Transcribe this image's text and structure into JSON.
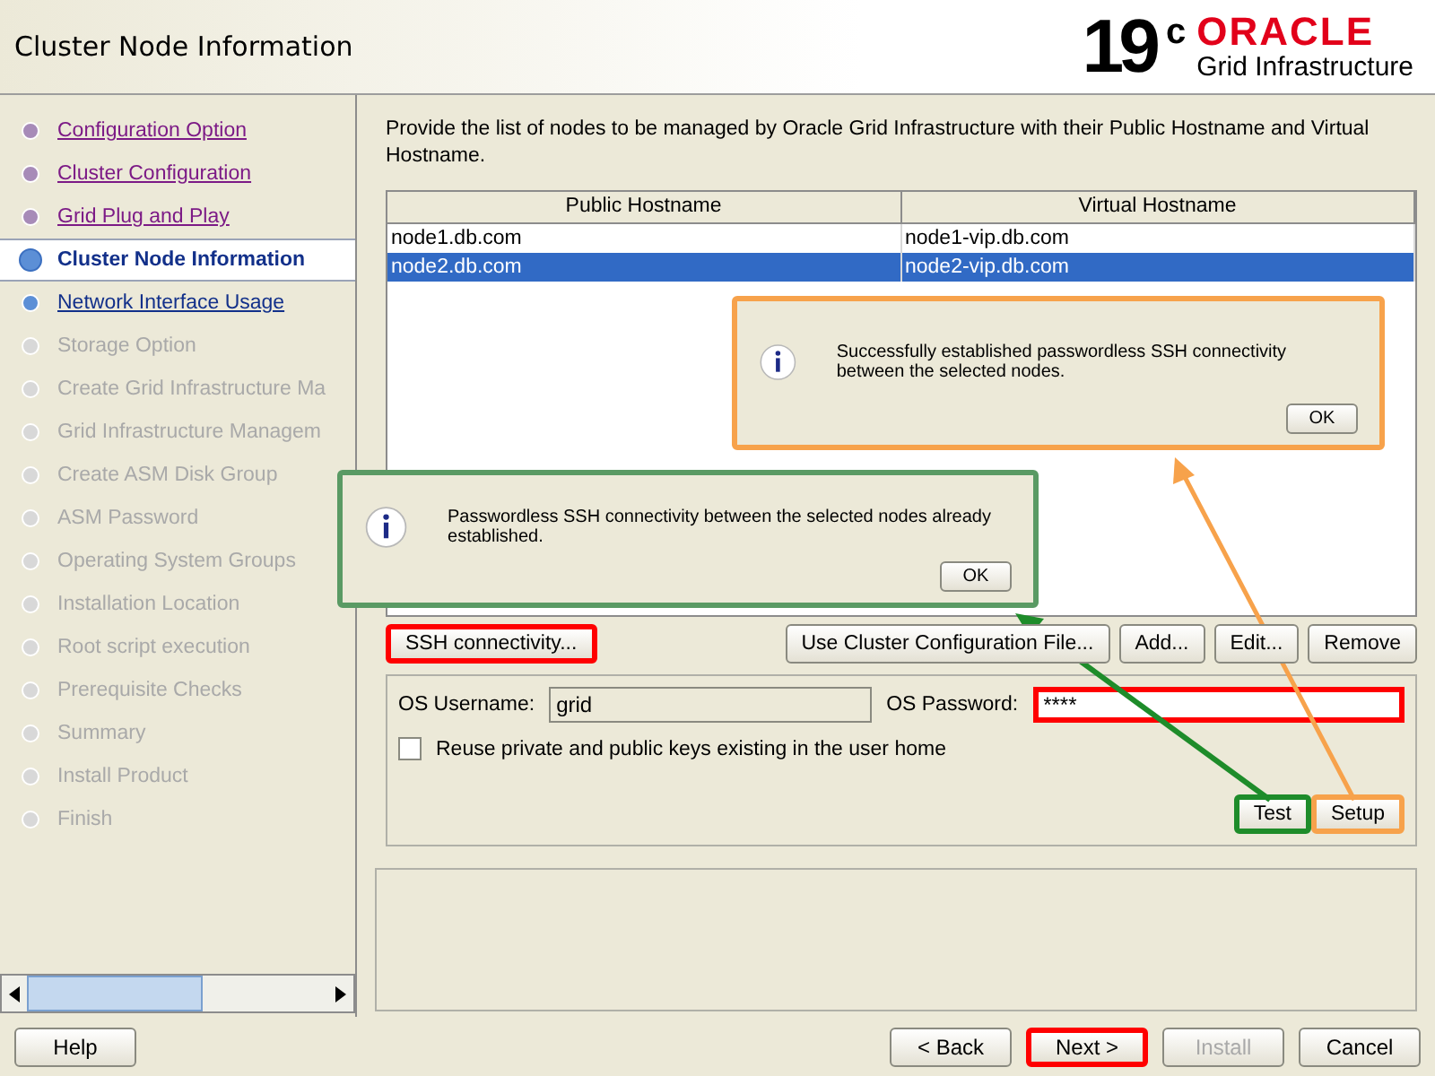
{
  "header": {
    "title": "Cluster Node Information",
    "logo": {
      "version": "19",
      "suffix": "c",
      "brand": "ORACLE",
      "product": "Grid Infrastructure"
    }
  },
  "steps": [
    {
      "label": "Configuration Option",
      "kind": "done",
      "selected": false
    },
    {
      "label": "Cluster Configuration",
      "kind": "done",
      "selected": false
    },
    {
      "label": "Grid Plug and Play",
      "kind": "done",
      "selected": false
    },
    {
      "label": "Cluster Node Information",
      "kind": "current",
      "selected": true
    },
    {
      "label": "Network Interface Usage",
      "kind": "next",
      "selected": false
    },
    {
      "label": "Storage Option",
      "kind": "pending",
      "selected": false
    },
    {
      "label": "Create Grid Infrastructure Ma",
      "kind": "pending",
      "selected": false
    },
    {
      "label": "Grid Infrastructure Managem",
      "kind": "pending",
      "selected": false
    },
    {
      "label": "Create ASM Disk Group",
      "kind": "pending",
      "selected": false
    },
    {
      "label": "ASM Password",
      "kind": "pending",
      "selected": false
    },
    {
      "label": "Operating System Groups",
      "kind": "pending",
      "selected": false
    },
    {
      "label": "Installation Location",
      "kind": "pending",
      "selected": false
    },
    {
      "label": "Root script execution",
      "kind": "pending",
      "selected": false
    },
    {
      "label": "Prerequisite Checks",
      "kind": "pending",
      "selected": false
    },
    {
      "label": "Summary",
      "kind": "pending",
      "selected": false
    },
    {
      "label": "Install Product",
      "kind": "pending",
      "selected": false
    },
    {
      "label": "Finish",
      "kind": "pending",
      "selected": false
    }
  ],
  "instruction": "Provide the list of nodes to be managed by Oracle Grid Infrastructure with their Public Hostname and Virtual Hostname.",
  "table": {
    "columns": [
      "Public Hostname",
      "Virtual Hostname"
    ],
    "rows": [
      {
        "cells": [
          "node1.db.com",
          "node1-vip.db.com"
        ],
        "selected": false
      },
      {
        "cells": [
          "node2.db.com",
          "node2-vip.db.com"
        ],
        "selected": true
      }
    ]
  },
  "node_buttons": [
    {
      "label": "SSH connectivity...",
      "color": "#ff0000"
    },
    {
      "label": "Use Cluster Configuration File..."
    },
    {
      "label": "Add..."
    },
    {
      "label": "Edit..."
    },
    {
      "label": "Remove"
    }
  ],
  "ssh": {
    "username_label": "OS Username:",
    "username": "grid",
    "password_label": "OS Password:",
    "password": {
      "value": "****",
      "color": "#ff0000"
    },
    "reuse_keys": {
      "label": "Reuse private and public keys existing in the user home",
      "checked": false
    },
    "buttons": [
      {
        "label": "Test",
        "color": "#1e8c2a"
      },
      {
        "label": "Setup",
        "color": "#f7a24b"
      }
    ]
  },
  "dialogs": [
    {
      "message": "Successfully established passwordless SSH connectivity between the selected nodes.",
      "button": "OK",
      "color": "#f7a24b"
    },
    {
      "message": "Passwordless SSH connectivity between the selected nodes already established.",
      "button": "OK",
      "color": "#5a9a64"
    }
  ],
  "footer_buttons": [
    {
      "label": "Help",
      "disabled": false
    },
    {
      "label": "< Back",
      "disabled": false
    },
    {
      "label": "Next >",
      "disabled": false,
      "color": "#ff0000"
    },
    {
      "label": "Install",
      "disabled": true
    },
    {
      "label": "Cancel",
      "disabled": false
    }
  ]
}
